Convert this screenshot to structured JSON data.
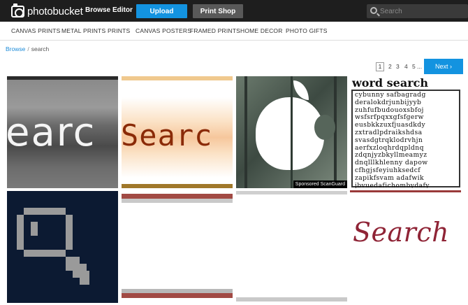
{
  "header": {
    "logo_text": "photobucket",
    "nav": [
      "Browse",
      "Editor"
    ],
    "upload_label": "Upload",
    "print_shop_label": "Print Shop",
    "search_placeholder": "Search"
  },
  "categories": [
    "CANVAS PRINTS",
    "METAL PRINTS",
    "PRINTS",
    "CANVAS POSTERS",
    "FRAMED PRINTS",
    "HOME DECOR",
    "PHOTO GIFTS"
  ],
  "breadcrumb": {
    "root": "Browse",
    "separator": "/",
    "current": "search"
  },
  "pagination": {
    "pages": [
      "1",
      "2",
      "3",
      "4",
      "5"
    ],
    "current": "1",
    "ellipsis": "...",
    "next_label": "Next ›"
  },
  "tiles": {
    "t1_text": "earc",
    "t2_text": "Searc",
    "t3_sponsor": "Sponsored ScanGuard",
    "t4_title": "word search",
    "t4_rows": [
      "cybunny safbagradg",
      "deralokdrjunbijyyb",
      "zuhfufbudouoxsbfoj",
      "wsfsrfpqxxgfsfgerw",
      "eusbkkzuxfjuasdkdy",
      "zxtradlpdraikshdsa",
      "svasdgtrqklodrvhjn",
      "aerfxzloqhrdqpldnq",
      "zdqnjyzbkyllmeamyz",
      "dnqlllkhlenny dapow",
      "cfhgjsfeyiuhksedcf",
      "zapikfsvam adafwik",
      "jbvuedafichombydafy"
    ],
    "t8_text": "Search"
  },
  "colors": {
    "topbar": "#1e1e1e",
    "accent": "#1393e0",
    "print_shop": "#595959"
  }
}
